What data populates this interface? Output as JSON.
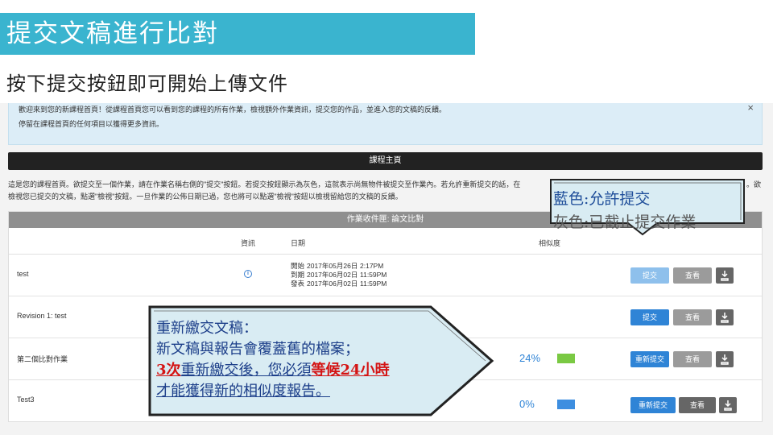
{
  "slide": {
    "title": "提交文稿進行比對",
    "subtitle": "按下提交按鈕即可開始上傳文件"
  },
  "banner": {
    "line1": "歡迎來到您的新課程首頁！從課程首頁您可以看到您的課程的所有作業，檢視額外作業資訊，提交您的作品，並進入您的文稿的反饋。",
    "line2": "停留在課程首頁的任何項目以獲得更多資訊。",
    "close": "×"
  },
  "course_bar": "課程主頁",
  "description": {
    "line1": "這是您的課程首頁。欲提交至一個作業，請在作業名稱右側的\"提交\"按鈕。若提交按鈕顯示為灰色，這就表示尚無物件被提交至作業內。若允許重新提交的話，在",
    "line1_end": "。欲",
    "line2": "檢視您已提交的文稿，點選\"檢視\"按鈕。一旦作業的公佈日期已過，您也將可以點選\"檢視\"按鈕以檢視留給您的文稿的反饋。"
  },
  "panel": {
    "header": "作業收件匣: 論文比對",
    "col_info": "資訊",
    "col_dates": "日期",
    "col_similarity": "相似度"
  },
  "rows": [
    {
      "title": "test",
      "info_icon": "i",
      "dates": [
        {
          "label": "開始",
          "date": "2017年05月26日",
          "time": "2:17PM"
        },
        {
          "label": "到期",
          "date": "2017年06月02日",
          "time": "11:59PM"
        },
        {
          "label": "發表",
          "date": "2017年06月02日",
          "time": "11:59PM"
        }
      ],
      "submit": "提交",
      "view": "查看"
    },
    {
      "title": "Revision 1: test",
      "submit": "提交",
      "view": "查看"
    },
    {
      "title": "第二個比對作業",
      "similarity": "24%",
      "submit": "重新提交",
      "view": "查看"
    },
    {
      "title": "Test3",
      "similarity": "0%",
      "submit": "重新提交",
      "view": "查看"
    }
  ],
  "legend": {
    "blue": "藍色:允許提交",
    "gray": "灰色:已截止提交作業"
  },
  "resubmit_note": {
    "line1": "重新繳交文稿：",
    "line2": "新文稿與報告會覆蓋舊的檔案；",
    "count": "3次",
    "line3_mid": "重新繳交後，您必須",
    "wait": "等候24小時",
    "line4": "才能獲得新的相似度報告。"
  },
  "colors": {
    "title_bg": "#3ab4cf",
    "submit_blue": "#2f84d6",
    "submit_disabled": "#8ec0ec",
    "similarity_green": "#7ac943",
    "similarity_blue": "#3d8ee0"
  }
}
